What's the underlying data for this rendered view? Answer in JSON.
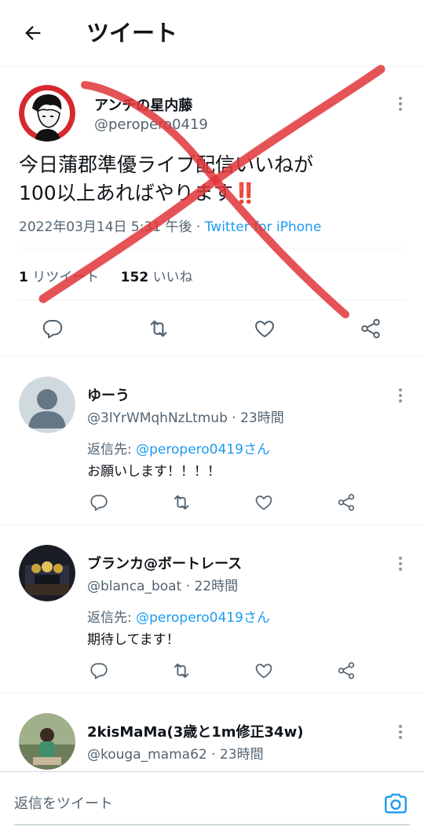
{
  "header": {
    "title": "ツイート"
  },
  "main_tweet": {
    "author_name": "アンチの星内藤",
    "author_handle": "@peropero0419",
    "text_line1": "今日蒲郡準優ライブ配信いいねが",
    "text_line2": "100以上あればやります",
    "emoji": "‼️",
    "datetime": "2022年03月14日 5:31 午後",
    "separator": " · ",
    "source": "Twitter for iPhone",
    "retweet_count": "1",
    "retweet_label": "リツイート",
    "like_count": "152",
    "like_label": "いいね"
  },
  "replies": [
    {
      "name": "ゆーう",
      "handle": "@3lYrWMqhNzLtmub",
      "time": "· 23時間",
      "reply_prefix": "返信先: ",
      "reply_to": "@peropero0419さん",
      "text": "お願いします！！！！"
    },
    {
      "name": "ブランカ@ボートレース",
      "handle": "@blanca_boat",
      "time": "· 22時間",
      "reply_prefix": "返信先: ",
      "reply_to": "@peropero0419さん",
      "text": "期待してます！"
    },
    {
      "name": "2kisMaMa(3歳と1m修正34w)",
      "handle": "@kouga_mama62",
      "time": "· 23時間"
    }
  ],
  "compose": {
    "placeholder": "返信をツイート"
  },
  "colors": {
    "accent": "#1d9bf0",
    "secondary_text": "#536471",
    "cross_mark": "#e0353a",
    "avatar_main_bg": "#d7282f"
  }
}
